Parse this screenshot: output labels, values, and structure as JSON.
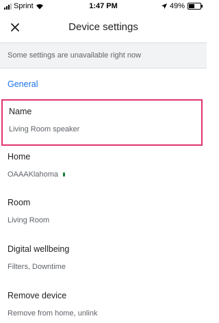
{
  "statusbar": {
    "carrier": "Sprint",
    "time": "1:47 PM",
    "battery": "49%",
    "battery_level": 0.49
  },
  "appbar": {
    "title": "Device settings"
  },
  "banner": {
    "text": "Some settings are unavailable right now"
  },
  "section": {
    "general": "General"
  },
  "settings": [
    {
      "label": "Name",
      "value": "Living Room speaker"
    },
    {
      "label": "Home",
      "value": "OAAAKlahoma"
    },
    {
      "label": "Room",
      "value": "Living Room"
    },
    {
      "label": "Digital wellbeing",
      "value": "Filters, Downtime"
    },
    {
      "label": "Remove device",
      "value": "Remove from home, unlink"
    }
  ],
  "colors": {
    "accent": "#1a73e8",
    "highlight": "#e0346f"
  }
}
